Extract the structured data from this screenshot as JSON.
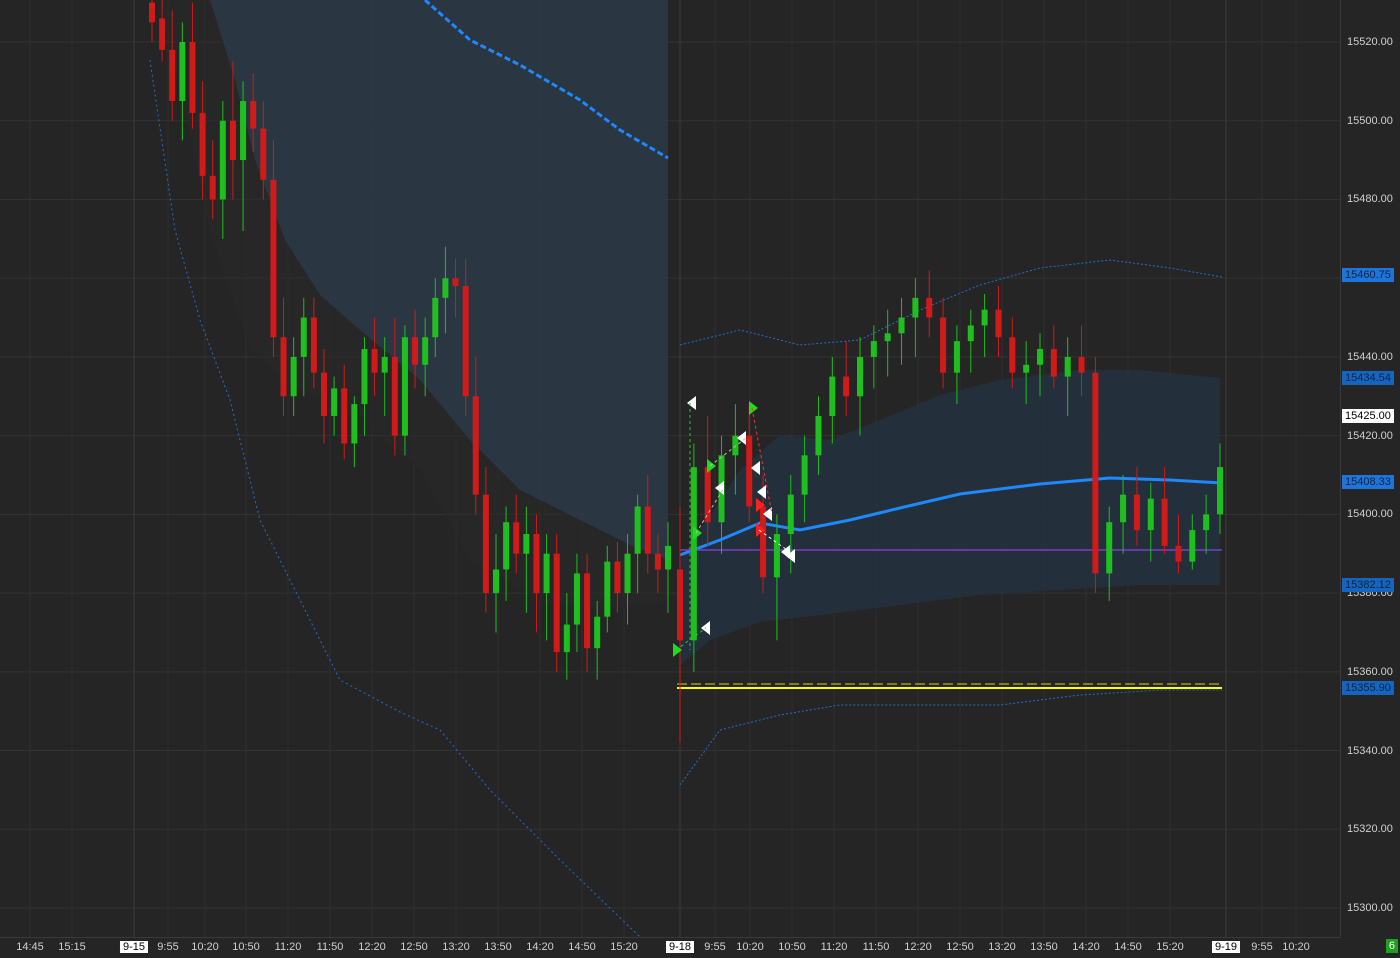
{
  "chart_data": {
    "type": "candlestick",
    "title": "",
    "price_ticks": [
      "15520.00",
      "15500.00",
      "15480.00",
      "15460.00",
      "15440.00",
      "15420.00",
      "15400.00",
      "15380.00",
      "15360.00",
      "15340.00",
      "15320.00",
      "15300.00"
    ],
    "price_flags": [
      {
        "value": "15460.75",
        "style": "blue2"
      },
      {
        "value": "15434.54",
        "style": "blue"
      },
      {
        "value": "15425.00",
        "style": "white"
      },
      {
        "value": "15408.33",
        "style": "blue2"
      },
      {
        "value": "15382.12",
        "style": "blue"
      },
      {
        "value": "15355.90",
        "style": "blue"
      }
    ],
    "time_labels": [
      {
        "text": "14:45",
        "date": false
      },
      {
        "text": "15:15",
        "date": false
      },
      {
        "text": "9-15",
        "date": true
      },
      {
        "text": "9:55",
        "date": false
      },
      {
        "text": "10:20",
        "date": false
      },
      {
        "text": "10:50",
        "date": false
      },
      {
        "text": "11:20",
        "date": false
      },
      {
        "text": "11:50",
        "date": false
      },
      {
        "text": "12:20",
        "date": false
      },
      {
        "text": "12:50",
        "date": false
      },
      {
        "text": "13:20",
        "date": false
      },
      {
        "text": "13:50",
        "date": false
      },
      {
        "text": "14:20",
        "date": false
      },
      {
        "text": "14:50",
        "date": false
      },
      {
        "text": "15:20",
        "date": false
      },
      {
        "text": "9-18",
        "date": true
      },
      {
        "text": "9:55",
        "date": false
      },
      {
        "text": "10:20",
        "date": false
      },
      {
        "text": "10:50",
        "date": false
      },
      {
        "text": "11:20",
        "date": false
      },
      {
        "text": "11:50",
        "date": false
      },
      {
        "text": "12:20",
        "date": false
      },
      {
        "text": "12:50",
        "date": false
      },
      {
        "text": "13:20",
        "date": false
      },
      {
        "text": "13:50",
        "date": false
      },
      {
        "text": "14:20",
        "date": false
      },
      {
        "text": "14:50",
        "date": false
      },
      {
        "text": "15:20",
        "date": false
      },
      {
        "text": "9-19",
        "date": true
      },
      {
        "text": "9:55",
        "date": false
      },
      {
        "text": "10:20",
        "date": false
      }
    ],
    "ylim": [
      15292,
      15530
    ],
    "candles": [
      [
        15530,
        15535,
        15520,
        15525
      ],
      [
        15526,
        15532,
        15515,
        15518
      ],
      [
        15518,
        15528,
        15500,
        15505
      ],
      [
        15505,
        15525,
        15495,
        15520
      ],
      [
        15520,
        15530,
        15498,
        15502
      ],
      [
        15502,
        15510,
        15480,
        15486
      ],
      [
        15486,
        15495,
        15475,
        15480
      ],
      [
        15480,
        15505,
        15470,
        15500
      ],
      [
        15500,
        15515,
        15480,
        15490
      ],
      [
        15490,
        15510,
        15472,
        15505
      ],
      [
        15505,
        15512,
        15492,
        15498
      ],
      [
        15498,
        15505,
        15480,
        15485
      ],
      [
        15485,
        15495,
        15440,
        15445
      ],
      [
        15445,
        15455,
        15425,
        15430
      ],
      [
        15430,
        15445,
        15425,
        15440
      ],
      [
        15440,
        15455,
        15430,
        15450
      ],
      [
        15450,
        15455,
        15432,
        15436
      ],
      [
        15436,
        15442,
        15418,
        15425
      ],
      [
        15425,
        15435,
        15420,
        15432
      ],
      [
        15432,
        15438,
        15414,
        15418
      ],
      [
        15418,
        15430,
        15412,
        15428
      ],
      [
        15428,
        15445,
        15420,
        15442
      ],
      [
        15442,
        15450,
        15430,
        15436
      ],
      [
        15436,
        15445,
        15425,
        15440
      ],
      [
        15440,
        15450,
        15415,
        15420
      ],
      [
        15420,
        15448,
        15415,
        15445
      ],
      [
        15445,
        15452,
        15432,
        15438
      ],
      [
        15438,
        15450,
        15430,
        15445
      ],
      [
        15445,
        15460,
        15440,
        15455
      ],
      [
        15455,
        15468,
        15446,
        15460
      ],
      [
        15460,
        15465,
        15450,
        15458
      ],
      [
        15458,
        15465,
        15425,
        15430
      ],
      [
        15430,
        15440,
        15400,
        15405
      ],
      [
        15405,
        15412,
        15375,
        15380
      ],
      [
        15380,
        15395,
        15370,
        15386
      ],
      [
        15386,
        15402,
        15378,
        15398
      ],
      [
        15398,
        15405,
        15385,
        15390
      ],
      [
        15390,
        15402,
        15375,
        15395
      ],
      [
        15395,
        15400,
        15370,
        15380
      ],
      [
        15380,
        15395,
        15368,
        15390
      ],
      [
        15390,
        15395,
        15360,
        15365
      ],
      [
        15365,
        15380,
        15358,
        15372
      ],
      [
        15372,
        15390,
        15365,
        15385
      ],
      [
        15385,
        15390,
        15360,
        15366
      ],
      [
        15366,
        15378,
        15358,
        15374
      ],
      [
        15374,
        15392,
        15370,
        15388
      ],
      [
        15388,
        15393,
        15375,
        15380
      ],
      [
        15380,
        15395,
        15372,
        15390
      ],
      [
        15390,
        15405,
        15380,
        15402
      ],
      [
        15402,
        15410,
        15385,
        15390
      ],
      [
        15390,
        15395,
        15380,
        15386
      ],
      [
        15386,
        15398,
        15375,
        15392
      ],
      [
        15386,
        15402,
        15342,
        15368
      ],
      [
        15368,
        15418,
        15360,
        15412
      ],
      [
        15412,
        15425,
        15392,
        15398
      ],
      [
        15398,
        15420,
        15390,
        15415
      ],
      [
        15415,
        15428,
        15405,
        15420
      ],
      [
        15420,
        15428,
        15398,
        15402
      ],
      [
        15402,
        15410,
        15380,
        15384
      ],
      [
        15384,
        15400,
        15368,
        15395
      ],
      [
        15395,
        15410,
        15385,
        15405
      ],
      [
        15405,
        15420,
        15398,
        15415
      ],
      [
        15415,
        15430,
        15410,
        15425
      ],
      [
        15425,
        15440,
        15418,
        15435
      ],
      [
        15435,
        15444,
        15425,
        15430
      ],
      [
        15430,
        15445,
        15420,
        15440
      ],
      [
        15440,
        15448,
        15432,
        15444
      ],
      [
        15444,
        15452,
        15435,
        15446
      ],
      [
        15446,
        15455,
        15438,
        15450
      ],
      [
        15450,
        15460,
        15440,
        15455
      ],
      [
        15455,
        15462,
        15445,
        15450
      ],
      [
        15450,
        15455,
        15432,
        15436
      ],
      [
        15436,
        15448,
        15428,
        15444
      ],
      [
        15444,
        15452,
        15436,
        15448
      ],
      [
        15448,
        15456,
        15440,
        15452
      ],
      [
        15452,
        15458,
        15440,
        15445
      ],
      [
        15445,
        15450,
        15432,
        15436
      ],
      [
        15436,
        15444,
        15428,
        15438
      ],
      [
        15438,
        15446,
        15430,
        15442
      ],
      [
        15442,
        15448,
        15432,
        15435
      ],
      [
        15435,
        15445,
        15425,
        15440
      ],
      [
        15440,
        15448,
        15430,
        15436
      ],
      [
        15436,
        15440,
        15380,
        15385
      ],
      [
        15385,
        15402,
        15378,
        15398
      ],
      [
        15398,
        15410,
        15390,
        15405
      ],
      [
        15405,
        15412,
        15392,
        15396
      ],
      [
        15396,
        15408,
        15388,
        15404
      ],
      [
        15404,
        15412,
        15390,
        15392
      ],
      [
        15392,
        15400,
        15385,
        15388
      ],
      [
        15388,
        15400,
        15386,
        15396
      ],
      [
        15396,
        15405,
        15390,
        15400
      ],
      [
        15400,
        15418,
        15395,
        15412
      ]
    ]
  },
  "corner_badge": "6"
}
